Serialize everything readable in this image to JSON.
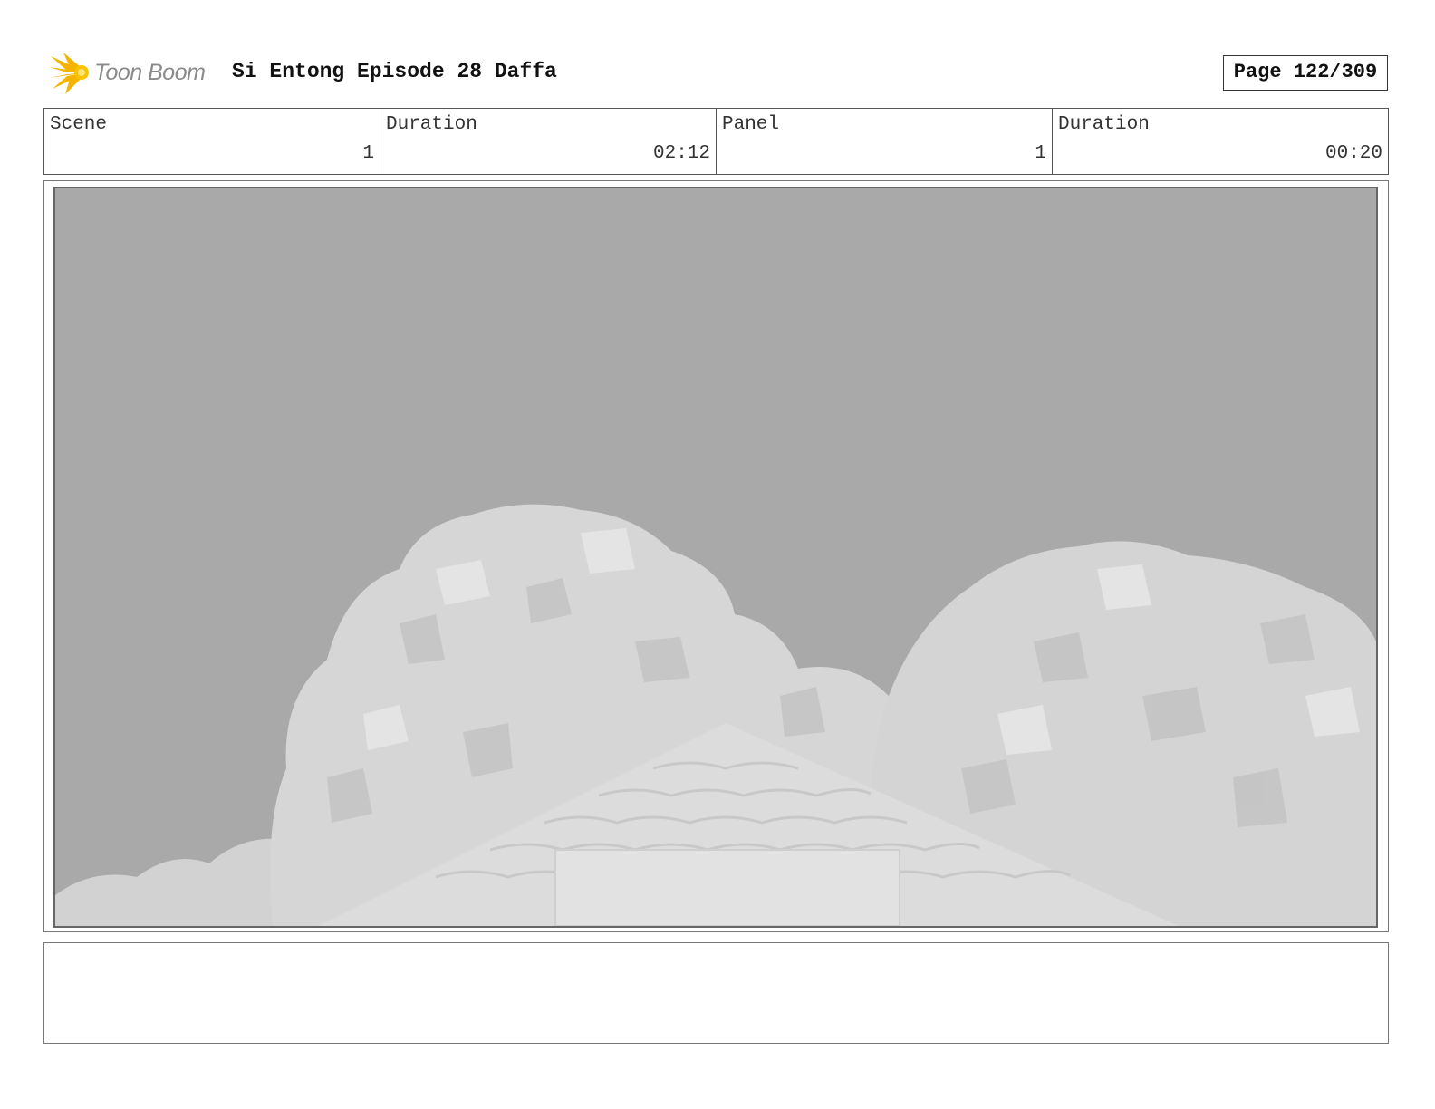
{
  "header": {
    "logo_text": "Toon Boom",
    "title": "Si Entong Episode 28 Daffa",
    "page": "Page 122/309"
  },
  "info": [
    {
      "label": "Scene",
      "value": "1"
    },
    {
      "label": "Duration",
      "value": "02:12"
    },
    {
      "label": "Panel",
      "value": "1"
    },
    {
      "label": "Duration",
      "value": "00:20"
    }
  ],
  "colors": {
    "sky": "#a9a9a9",
    "foliage": "#d8d8d8",
    "roof": "#dcdcdc",
    "logo_accent": "#f4b400"
  }
}
